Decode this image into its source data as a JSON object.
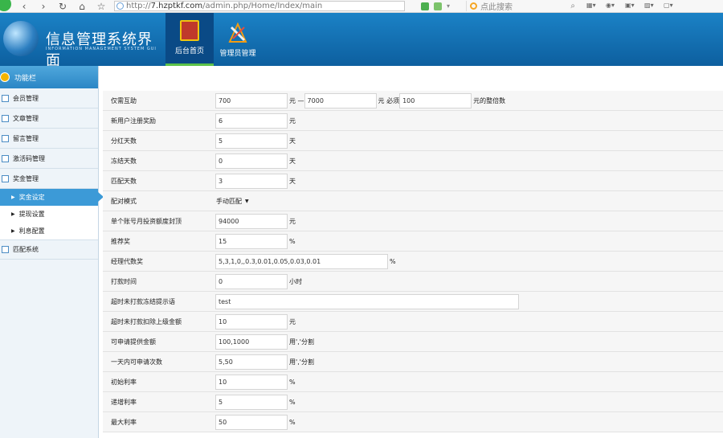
{
  "browser": {
    "url_prefix": "http://",
    "url_host": "7.hzptkf.com",
    "url_path": "/admin.php/Home/Index/main",
    "search_placeholder": "点此搜索"
  },
  "header": {
    "title": "信息管理系统界面",
    "subtitle": "INFORMATION MANAGEMENT SYSTEM GUI",
    "tabs": [
      {
        "label": "后台首页"
      },
      {
        "label": "管理员管理"
      }
    ]
  },
  "sidebar": {
    "head": "功能栏",
    "items": [
      {
        "label": "会员管理"
      },
      {
        "label": "文章管理"
      },
      {
        "label": "留言管理"
      },
      {
        "label": "激活码管理"
      },
      {
        "label": "奖金管理"
      }
    ],
    "subitems": [
      {
        "label": "奖金设定"
      },
      {
        "label": "提现设置"
      },
      {
        "label": "利息配置"
      }
    ],
    "last_item": {
      "label": "匹配系统"
    }
  },
  "form": {
    "rows": [
      {
        "label": "仅需互助",
        "v1": "700",
        "u1": "元 —",
        "v2": "7000",
        "u2": "元 必须",
        "v3": "100",
        "u3": "元的整倍数"
      },
      {
        "label": "新用户注册奖励",
        "value": "6",
        "unit": "元"
      },
      {
        "label": "分红天数",
        "value": "5",
        "unit": "天"
      },
      {
        "label": "冻结天数",
        "value": "0",
        "unit": "天"
      },
      {
        "label": "匹配天数",
        "value": "3",
        "unit": "天"
      },
      {
        "label": "配对模式",
        "value": "手动匹配"
      },
      {
        "label": "单个账号月投资额度封顶",
        "value": "94000",
        "unit": "元"
      },
      {
        "label": "推荐奖",
        "value": "15",
        "unit": "%"
      },
      {
        "label": "经理代数奖",
        "value": "5,3,1,0,,0.3,0.01,0.05,0.03,0.01",
        "unit": "%"
      },
      {
        "label": "打款时间",
        "value": "0",
        "unit": "小时"
      },
      {
        "label": "超时未打款冻结提示语",
        "value": "test"
      },
      {
        "label": "超时未打款扣除上级金额",
        "value": "10",
        "unit": "元"
      },
      {
        "label": "可申请提供金额",
        "value": "100,1000",
        "unit": "用','分割"
      },
      {
        "label": "一天内可申请次数",
        "value": "5,50",
        "unit": "用','分割"
      },
      {
        "label": "初始利率",
        "value": "10",
        "unit": "%"
      },
      {
        "label": "递增利率",
        "value": "5",
        "unit": "%"
      },
      {
        "label": "最大利率",
        "value": "50",
        "unit": "%"
      }
    ]
  }
}
